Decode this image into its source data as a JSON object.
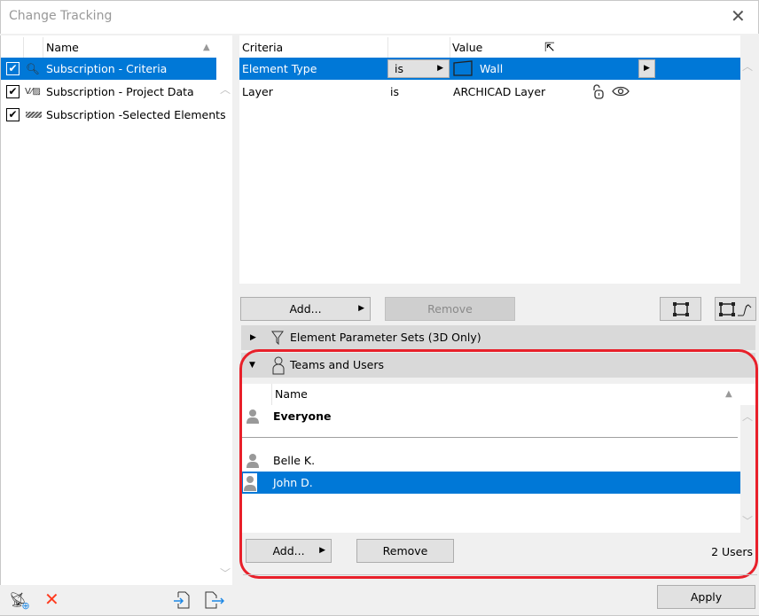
{
  "window": {
    "title": "Change Tracking"
  },
  "subscriptions": {
    "header": "Name",
    "items": [
      {
        "label": "Subscription - Criteria",
        "checked": true,
        "icon": "criteria-search-icon",
        "selected": true
      },
      {
        "label": "Subscription - Project Data",
        "checked": true,
        "icon": "project-data-icon",
        "selected": false
      },
      {
        "label": "Subscription -Selected Elements",
        "checked": true,
        "icon": "hatch-selected-icon",
        "selected": false
      }
    ]
  },
  "criteria": {
    "headers": {
      "criteria": "Criteria",
      "operator": "",
      "value": "Value"
    },
    "rows": [
      {
        "criteria": "Element Type",
        "operator": "is",
        "value": "Wall",
        "selected": true
      },
      {
        "criteria": "Layer",
        "operator": "is",
        "value": "ARCHICAD Layer",
        "selected": false
      }
    ],
    "add_label": "Add...",
    "remove_label": "Remove"
  },
  "sections": {
    "parameter_sets": "Element Parameter Sets (3D Only)",
    "teams": "Teams and Users"
  },
  "users": {
    "header": "Name",
    "everyone": "Everyone",
    "items": [
      {
        "name": "Belle K.",
        "selected": false
      },
      {
        "name": "John D.",
        "selected": true
      }
    ],
    "add_label": "Add...",
    "remove_label": "Remove",
    "count": "2 Users"
  },
  "footer": {
    "apply_label": "Apply"
  },
  "colors": {
    "selection": "#0078d7",
    "highlight": "#e8202a",
    "delete": "#ff3b1f",
    "accent_icon": "#1e88e5"
  }
}
